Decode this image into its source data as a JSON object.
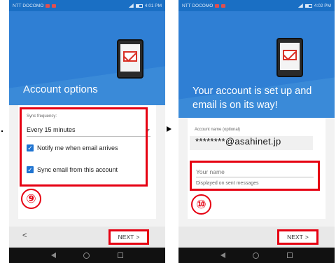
{
  "status_bar": {
    "carrier": "NTT DOCOMO",
    "time_left": "4:01 PM",
    "time_right": "4:02 PM"
  },
  "left": {
    "title": "Account options",
    "sync_label": "Sync frequency:",
    "sync_value": "Every 15 minutes",
    "checkbox_1": "Notify me when email arrives",
    "checkbox_2": "Sync email from this account",
    "badge": "⑨",
    "back": "<",
    "next": "NEXT",
    "next_chevron": ">"
  },
  "right": {
    "title": "Your account is set up and email is on its way!",
    "account_label": "Account name (optional)",
    "account_value": "********@asahinet.jp",
    "name_placeholder": "Your name",
    "name_helper": "Displayed on sent messages",
    "badge": "⑩",
    "next": "NEXT",
    "next_chevron": ">"
  },
  "colors": {
    "highlight": "#e60012",
    "header_blue": "#2f7fd4",
    "checkbox_blue": "#1f74d1"
  }
}
